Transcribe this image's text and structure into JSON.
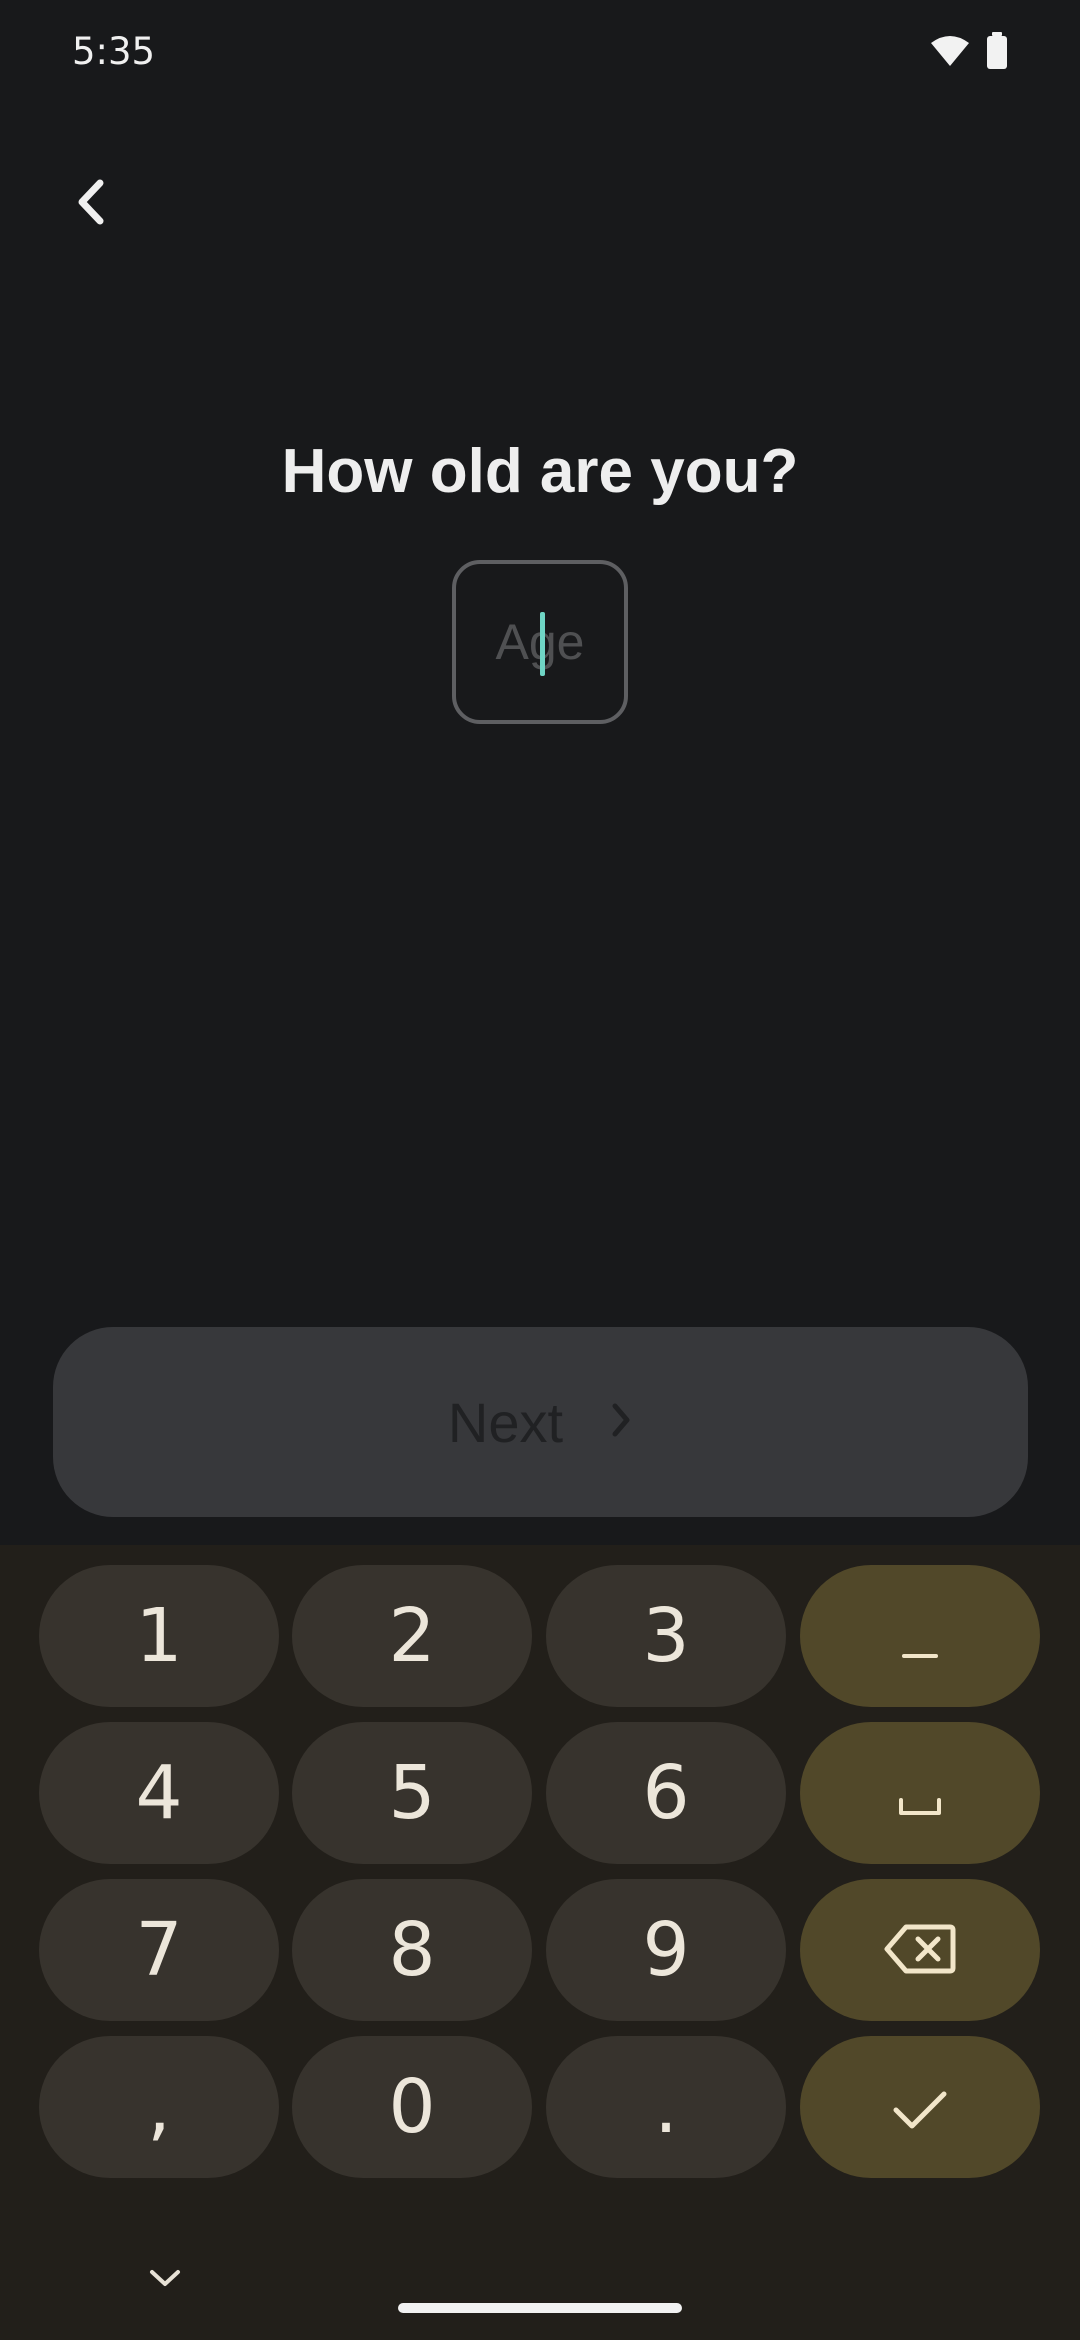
{
  "status_bar": {
    "time": "5:35",
    "icons": [
      "wifi-icon",
      "battery-icon"
    ]
  },
  "header": {
    "back_icon": "chevron-left-icon"
  },
  "question": {
    "title": "How old are you?"
  },
  "age_input": {
    "placeholder": "Age",
    "value": ""
  },
  "next_button": {
    "label": "Next",
    "icon": "chevron-right-icon",
    "enabled": false
  },
  "keyboard": {
    "digit_keys": [
      "1",
      "2",
      "3",
      "4",
      "5",
      "6",
      "7",
      "8",
      "9",
      "0"
    ],
    "comma_key": ",",
    "period_key": ".",
    "action_keys": [
      "minus-icon",
      "space-icon",
      "backspace-icon",
      "check-icon"
    ],
    "collapse_icon": "chevron-down-icon"
  },
  "colors": {
    "background": "#18191b",
    "keyboard_background": "#221f1a",
    "key": "#37332d",
    "accent_key": "#514829",
    "cursor": "#6fd5c5",
    "disabled_button": "#37383b"
  }
}
